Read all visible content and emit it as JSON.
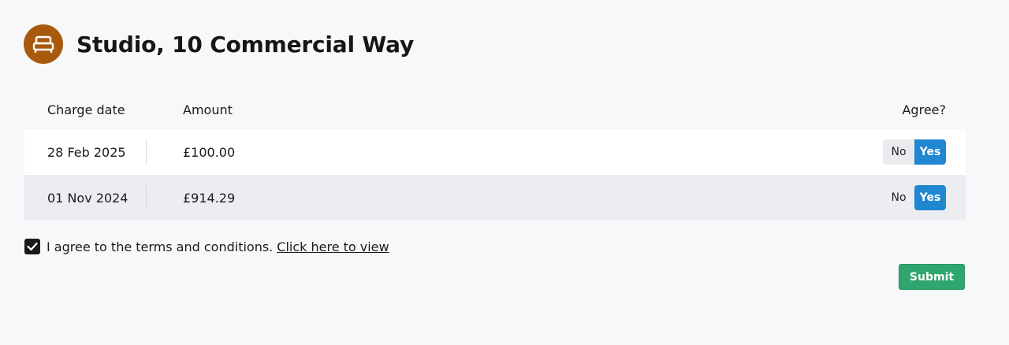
{
  "header": {
    "title": "Studio, 10 Commercial Way",
    "icon": "bed-icon",
    "icon_color": "#a8590b"
  },
  "table": {
    "columns": {
      "date": "Charge date",
      "amount": "Amount",
      "agree": "Agree?"
    },
    "rows": [
      {
        "date": "28 Feb 2025",
        "amount": "£100.00",
        "no_label": "No",
        "yes_label": "Yes",
        "selected": "Yes"
      },
      {
        "date": "01 Nov 2024",
        "amount": "£914.29",
        "no_label": "No",
        "yes_label": "Yes",
        "selected": "Yes"
      }
    ]
  },
  "terms": {
    "checked": true,
    "text": "I agree to the terms and conditions.",
    "link_text": "Click here to view"
  },
  "submit": {
    "label": "Submit",
    "color": "#2fa66e"
  },
  "colors": {
    "accent": "#2187d0",
    "background": "#f7f8fa"
  }
}
